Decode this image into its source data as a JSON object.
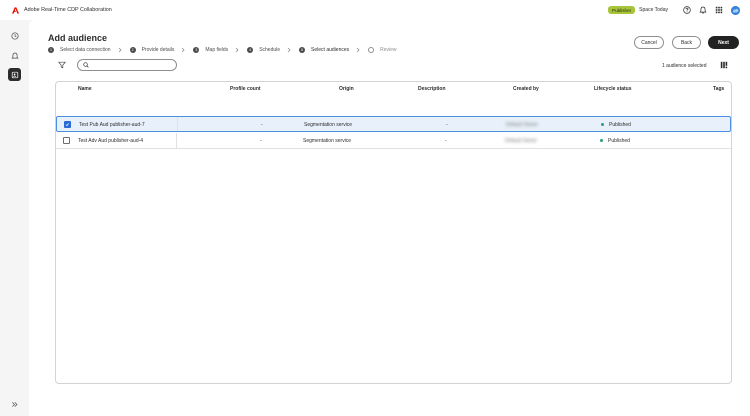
{
  "app": {
    "title": "Adobe Real-Time CDP Collaboration"
  },
  "header": {
    "role_badge": "Publisher",
    "org_name": "Space Today"
  },
  "page": {
    "title": "Add audience"
  },
  "steps": [
    {
      "number": "1",
      "label": "Select data connection",
      "state": "done"
    },
    {
      "number": "2",
      "label": "Provide details",
      "state": "done"
    },
    {
      "number": "3",
      "label": "Map fields",
      "state": "done"
    },
    {
      "number": "4",
      "label": "Schedule",
      "state": "done"
    },
    {
      "number": "5",
      "label": "Select audiences",
      "state": "current"
    },
    {
      "number": "",
      "label": "Review",
      "state": "pending"
    }
  ],
  "actions": {
    "cancel": "Cancel",
    "back": "Back",
    "next": "Next"
  },
  "toolbar": {
    "search_placeholder": "",
    "selected_count": "1 audience selected"
  },
  "table": {
    "columns": {
      "name": "Name",
      "profile_count": "Profile count",
      "origin": "Origin",
      "description": "Description",
      "created_by": "Created by",
      "lifecycle_status": "Lifecycle status",
      "tags": "Tags"
    },
    "rows": [
      {
        "name": "Test Pub Aud publisher-aud-7",
        "profile_count": "-",
        "origin": "Segmentation service",
        "description": "-",
        "created_by": "Default Owner",
        "lifecycle_status": "Published",
        "selected": true
      },
      {
        "name": "Test Adv Aud publisher-aud-4",
        "profile_count": "-",
        "origin": "Segmentation service",
        "description": "-",
        "created_by": "Default Owner",
        "lifecycle_status": "Published",
        "selected": false
      }
    ]
  },
  "colors": {
    "accent": "#2a6ad8",
    "badge": "#a8c43a",
    "status_published": "#2d9d78",
    "primary_button": "#222222"
  },
  "icons": {
    "rail": [
      "clock-icon",
      "bell-icon",
      "audience-icon",
      "chevron-double-right-icon"
    ],
    "top": [
      "help-icon",
      "bell-icon",
      "app-grid-icon",
      "avatar"
    ]
  }
}
